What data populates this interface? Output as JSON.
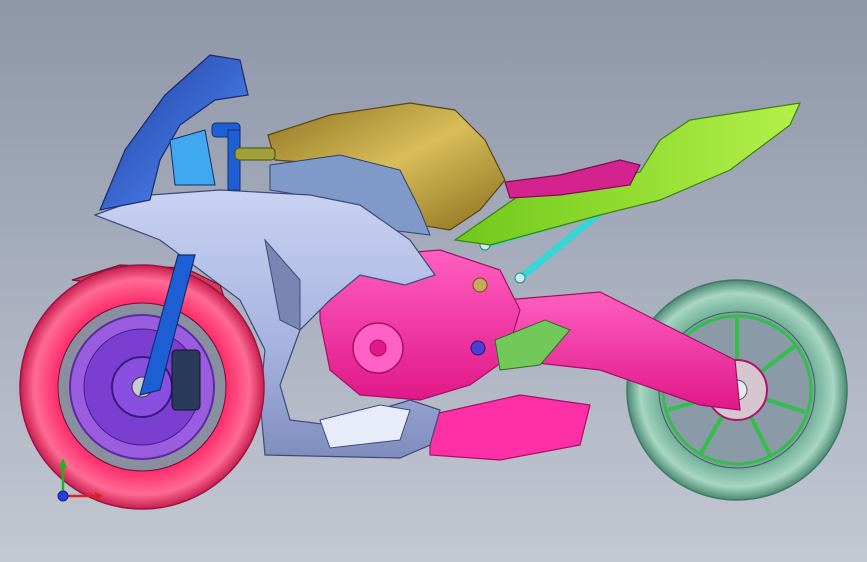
{
  "viewport": {
    "background_top": "#8e96a8",
    "background_bottom": "#c3c8d2"
  },
  "model": {
    "parts": [
      {
        "name": "front-wheel",
        "color": "#ff2f6e"
      },
      {
        "name": "front-brake-disc",
        "color": "#8a3fd6"
      },
      {
        "name": "rear-wheel",
        "color": "#6fae97"
      },
      {
        "name": "rear-rim",
        "color": "#2fbf4a"
      },
      {
        "name": "fairing",
        "color": "#a9b6e2"
      },
      {
        "name": "windscreen",
        "color": "#2c4fb5"
      },
      {
        "name": "fuel-tank",
        "color": "#b99a3a"
      },
      {
        "name": "frame-engine",
        "color": "#ff2fa5"
      },
      {
        "name": "seat",
        "color": "#d4238f"
      },
      {
        "name": "tail",
        "color": "#8ee62a"
      },
      {
        "name": "subframe",
        "color": "#35d6d6"
      },
      {
        "name": "front-fork",
        "color": "#1f5fd6"
      }
    ]
  },
  "triad": {
    "x_color": "#e02020",
    "y_color": "#20b020",
    "z_color": "#2040e0"
  }
}
